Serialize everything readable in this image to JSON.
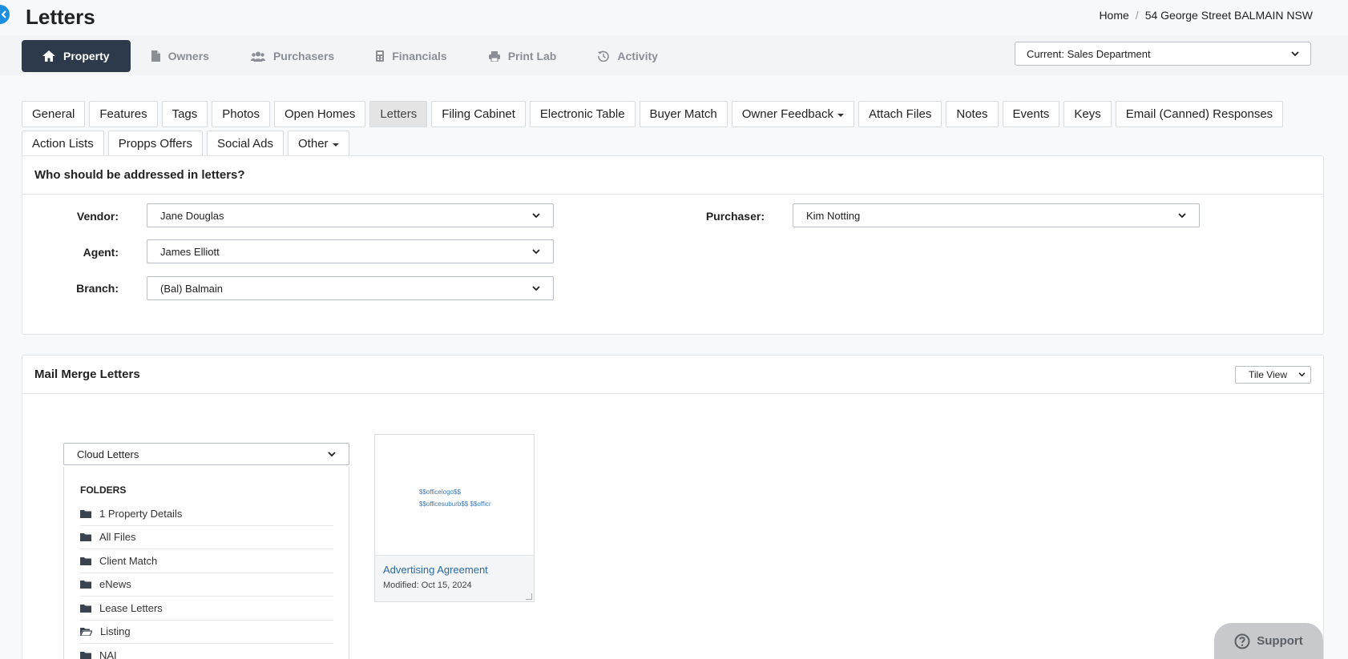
{
  "header": {
    "title": "Letters",
    "breadcrumb": [
      "Home",
      "54 George Street BALMAIN NSW"
    ]
  },
  "nav": [
    {
      "label": "Property",
      "icon": "home-icon"
    },
    {
      "label": "Owners",
      "icon": "document-icon"
    },
    {
      "label": "Purchasers",
      "icon": "users-icon"
    },
    {
      "label": "Financials",
      "icon": "calculator-icon"
    },
    {
      "label": "Print Lab",
      "icon": "printer-icon"
    },
    {
      "label": "Activity",
      "icon": "history-icon"
    }
  ],
  "department_select": "Current: Sales Department",
  "tabs": [
    {
      "label": "General"
    },
    {
      "label": "Features"
    },
    {
      "label": "Tags"
    },
    {
      "label": "Photos"
    },
    {
      "label": "Open Homes"
    },
    {
      "label": "Letters"
    },
    {
      "label": "Filing Cabinet"
    },
    {
      "label": "Electronic Table"
    },
    {
      "label": "Buyer Match"
    },
    {
      "label": "Owner Feedback"
    },
    {
      "label": "Attach Files"
    },
    {
      "label": "Notes"
    },
    {
      "label": "Events"
    },
    {
      "label": "Keys"
    },
    {
      "label": "Email (Canned) Responses"
    },
    {
      "label": "Action Lists"
    },
    {
      "label": "Propps Offers"
    },
    {
      "label": "Social Ads"
    },
    {
      "label": "Other"
    }
  ],
  "addressed": {
    "heading": "Who should be addressed in letters?",
    "vendor_label": "Vendor:",
    "vendor_value": "Jane Douglas",
    "agent_label": "Agent:",
    "agent_value": "James Elliott",
    "branch_label": "Branch:",
    "branch_value": "(Bal) Balmain",
    "purchaser_label": "Purchaser:",
    "purchaser_value": "Kim Notting"
  },
  "mailmerge": {
    "heading": "Mail Merge Letters",
    "view_select": "Tile View",
    "source_select": "Cloud Letters",
    "folders_title": "FOLDERS",
    "folders": [
      {
        "label": "1 Property Details",
        "open": false
      },
      {
        "label": "All Files",
        "open": false
      },
      {
        "label": "Client Match",
        "open": false
      },
      {
        "label": "eNews",
        "open": false
      },
      {
        "label": "Lease Letters",
        "open": false
      },
      {
        "label": "Listing",
        "open": true
      },
      {
        "label": "NAI",
        "open": false
      }
    ],
    "letter": {
      "preview_lines": [
        "$$officelogo$$",
        "$$officesuburb$$ $$officr"
      ],
      "name": "Advertising Agreement",
      "modified": "Modified: Oct 15, 2024"
    }
  },
  "support_label": "Support",
  "colors": {
    "nav_active": "#2c3a4c",
    "accent": "#1a8fe0",
    "link": "#2a6aa8"
  }
}
